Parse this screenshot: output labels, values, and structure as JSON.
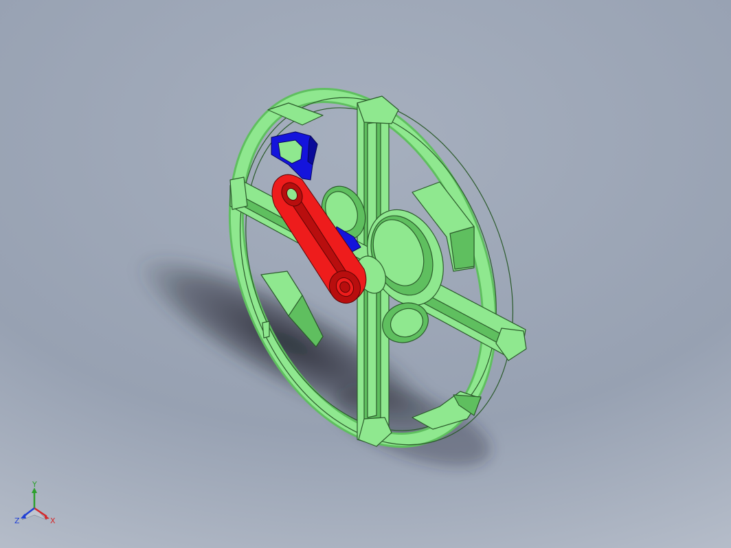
{
  "viewport": {
    "part_colors": {
      "wheel": "#8fe88f",
      "wheel_shade": "#5fbf5f",
      "link": "#ee1c1c",
      "link_shade": "#b80e0e",
      "bracket": "#1414dc",
      "bracket_shade": "#0a0a99",
      "outline": "#2a5a2a"
    }
  },
  "triad": {
    "y_label": "Y",
    "x_label": "X",
    "z_label": "Z",
    "y_color": "#2ca02c",
    "x_color": "#d62728",
    "z_color": "#1f3fd6"
  }
}
